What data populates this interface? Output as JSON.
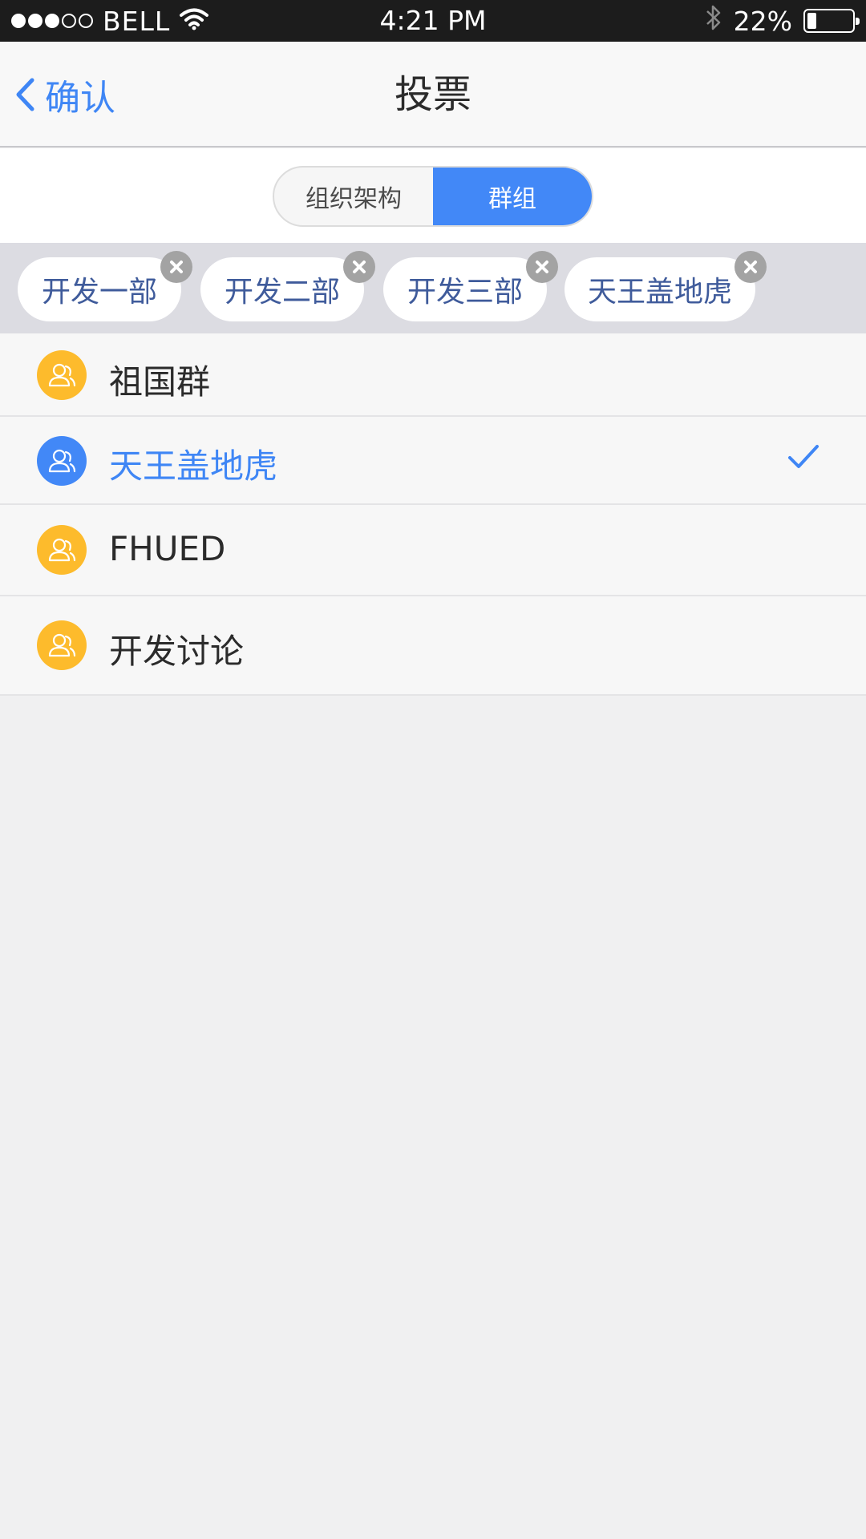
{
  "status_bar": {
    "carrier": "BELL",
    "time": "4:21 PM",
    "battery": "22%",
    "battery_level": 0.22,
    "signal_bars_filled": 3,
    "signal_bars_total": 5
  },
  "nav": {
    "back_label": "确认",
    "title": "投票"
  },
  "segment": {
    "options": [
      "组织架构",
      "群组"
    ],
    "selected": "群组"
  },
  "chips": [
    "开发一部",
    "开发二部",
    "开发三部",
    "天王盖地虎"
  ],
  "list": {
    "items": [
      {
        "label": "祖国群",
        "selected": false
      },
      {
        "label": "天王盖地虎",
        "selected": true
      },
      {
        "label": "FHUED",
        "selected": false
      },
      {
        "label": "开发讨论",
        "selected": false
      }
    ]
  },
  "colors": {
    "accent": "#3f86f5",
    "avatar_default": "#fdbb2c",
    "avatar_selected": "#4288f7",
    "chip_text": "#3f5b9b"
  }
}
